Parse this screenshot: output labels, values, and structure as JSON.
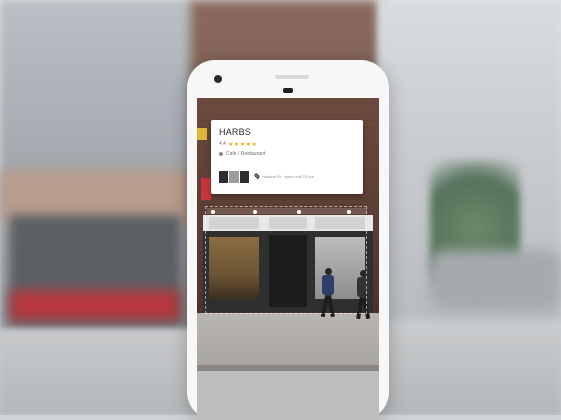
{
  "card": {
    "name": "HARBS",
    "rating_value": "4.4",
    "stars": "★★★★★",
    "category": "Cafe / Restaurant",
    "address": "Hudson St · open until 10 pm"
  },
  "icons": {
    "map_pin": "pin-icon",
    "category": "category-icon",
    "camera": "camera-icon"
  },
  "colors": {
    "star": "#f2a71b",
    "card_bg": "#ffffff",
    "phone_body": "#f7f7f7"
  }
}
